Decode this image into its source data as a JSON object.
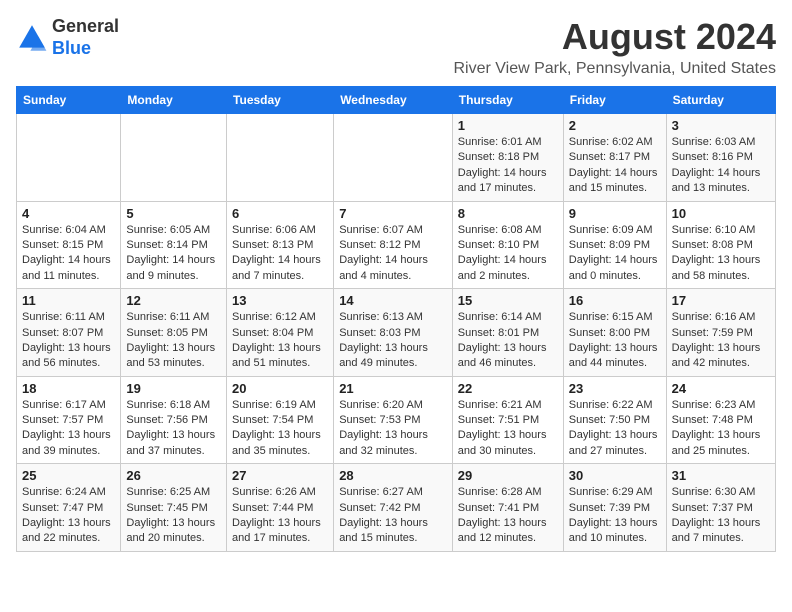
{
  "logo": {
    "general": "General",
    "blue": "Blue"
  },
  "title": "August 2024",
  "subtitle": "River View Park, Pennsylvania, United States",
  "days_of_week": [
    "Sunday",
    "Monday",
    "Tuesday",
    "Wednesday",
    "Thursday",
    "Friday",
    "Saturday"
  ],
  "weeks": [
    [
      {
        "day": "",
        "info": ""
      },
      {
        "day": "",
        "info": ""
      },
      {
        "day": "",
        "info": ""
      },
      {
        "day": "",
        "info": ""
      },
      {
        "day": "1",
        "info": "Sunrise: 6:01 AM\nSunset: 8:18 PM\nDaylight: 14 hours and 17 minutes."
      },
      {
        "day": "2",
        "info": "Sunrise: 6:02 AM\nSunset: 8:17 PM\nDaylight: 14 hours and 15 minutes."
      },
      {
        "day": "3",
        "info": "Sunrise: 6:03 AM\nSunset: 8:16 PM\nDaylight: 14 hours and 13 minutes."
      }
    ],
    [
      {
        "day": "4",
        "info": "Sunrise: 6:04 AM\nSunset: 8:15 PM\nDaylight: 14 hours and 11 minutes."
      },
      {
        "day": "5",
        "info": "Sunrise: 6:05 AM\nSunset: 8:14 PM\nDaylight: 14 hours and 9 minutes."
      },
      {
        "day": "6",
        "info": "Sunrise: 6:06 AM\nSunset: 8:13 PM\nDaylight: 14 hours and 7 minutes."
      },
      {
        "day": "7",
        "info": "Sunrise: 6:07 AM\nSunset: 8:12 PM\nDaylight: 14 hours and 4 minutes."
      },
      {
        "day": "8",
        "info": "Sunrise: 6:08 AM\nSunset: 8:10 PM\nDaylight: 14 hours and 2 minutes."
      },
      {
        "day": "9",
        "info": "Sunrise: 6:09 AM\nSunset: 8:09 PM\nDaylight: 14 hours and 0 minutes."
      },
      {
        "day": "10",
        "info": "Sunrise: 6:10 AM\nSunset: 8:08 PM\nDaylight: 13 hours and 58 minutes."
      }
    ],
    [
      {
        "day": "11",
        "info": "Sunrise: 6:11 AM\nSunset: 8:07 PM\nDaylight: 13 hours and 56 minutes."
      },
      {
        "day": "12",
        "info": "Sunrise: 6:11 AM\nSunset: 8:05 PM\nDaylight: 13 hours and 53 minutes."
      },
      {
        "day": "13",
        "info": "Sunrise: 6:12 AM\nSunset: 8:04 PM\nDaylight: 13 hours and 51 minutes."
      },
      {
        "day": "14",
        "info": "Sunrise: 6:13 AM\nSunset: 8:03 PM\nDaylight: 13 hours and 49 minutes."
      },
      {
        "day": "15",
        "info": "Sunrise: 6:14 AM\nSunset: 8:01 PM\nDaylight: 13 hours and 46 minutes."
      },
      {
        "day": "16",
        "info": "Sunrise: 6:15 AM\nSunset: 8:00 PM\nDaylight: 13 hours and 44 minutes."
      },
      {
        "day": "17",
        "info": "Sunrise: 6:16 AM\nSunset: 7:59 PM\nDaylight: 13 hours and 42 minutes."
      }
    ],
    [
      {
        "day": "18",
        "info": "Sunrise: 6:17 AM\nSunset: 7:57 PM\nDaylight: 13 hours and 39 minutes."
      },
      {
        "day": "19",
        "info": "Sunrise: 6:18 AM\nSunset: 7:56 PM\nDaylight: 13 hours and 37 minutes."
      },
      {
        "day": "20",
        "info": "Sunrise: 6:19 AM\nSunset: 7:54 PM\nDaylight: 13 hours and 35 minutes."
      },
      {
        "day": "21",
        "info": "Sunrise: 6:20 AM\nSunset: 7:53 PM\nDaylight: 13 hours and 32 minutes."
      },
      {
        "day": "22",
        "info": "Sunrise: 6:21 AM\nSunset: 7:51 PM\nDaylight: 13 hours and 30 minutes."
      },
      {
        "day": "23",
        "info": "Sunrise: 6:22 AM\nSunset: 7:50 PM\nDaylight: 13 hours and 27 minutes."
      },
      {
        "day": "24",
        "info": "Sunrise: 6:23 AM\nSunset: 7:48 PM\nDaylight: 13 hours and 25 minutes."
      }
    ],
    [
      {
        "day": "25",
        "info": "Sunrise: 6:24 AM\nSunset: 7:47 PM\nDaylight: 13 hours and 22 minutes."
      },
      {
        "day": "26",
        "info": "Sunrise: 6:25 AM\nSunset: 7:45 PM\nDaylight: 13 hours and 20 minutes."
      },
      {
        "day": "27",
        "info": "Sunrise: 6:26 AM\nSunset: 7:44 PM\nDaylight: 13 hours and 17 minutes."
      },
      {
        "day": "28",
        "info": "Sunrise: 6:27 AM\nSunset: 7:42 PM\nDaylight: 13 hours and 15 minutes."
      },
      {
        "day": "29",
        "info": "Sunrise: 6:28 AM\nSunset: 7:41 PM\nDaylight: 13 hours and 12 minutes."
      },
      {
        "day": "30",
        "info": "Sunrise: 6:29 AM\nSunset: 7:39 PM\nDaylight: 13 hours and 10 minutes."
      },
      {
        "day": "31",
        "info": "Sunrise: 6:30 AM\nSunset: 7:37 PM\nDaylight: 13 hours and 7 minutes."
      }
    ]
  ]
}
